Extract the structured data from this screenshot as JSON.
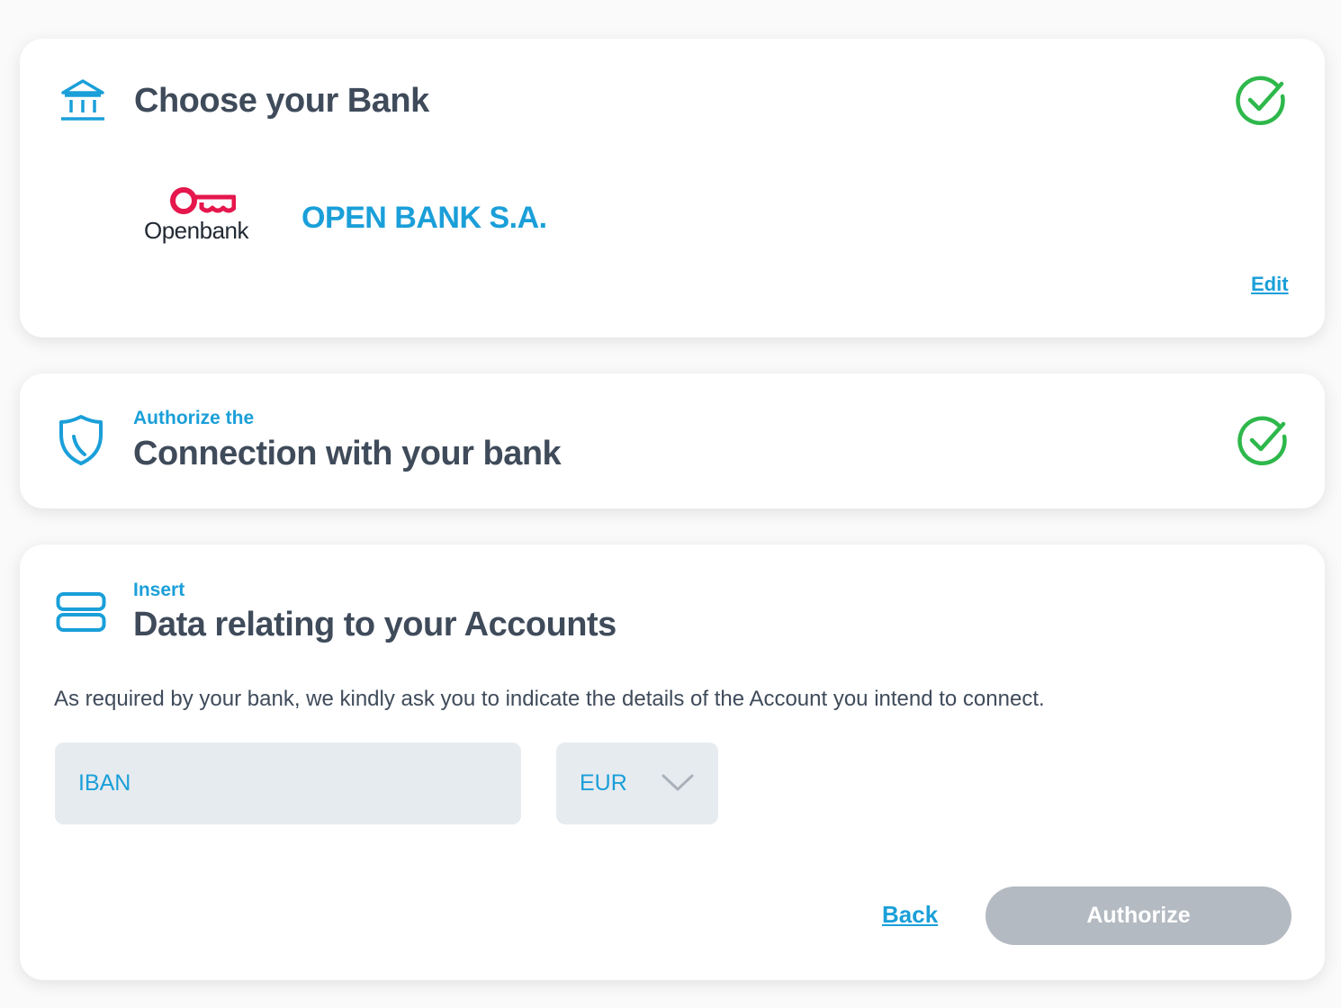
{
  "steps": {
    "bank": {
      "title": "Choose your Bank",
      "bank_name": "OPEN BANK S.A.",
      "bank_logo_text": "Openbank",
      "edit_label": "Edit",
      "status": "completed"
    },
    "authorize": {
      "pretitle": "Authorize the",
      "title": "Connection with your bank",
      "status": "completed"
    },
    "accounts": {
      "pretitle": "Insert",
      "title": "Data relating to your Accounts",
      "description": "As required by your bank, we kindly ask you to indicate the details of the Account you intend to connect.",
      "iban_placeholder": "IBAN",
      "currency_selected": "EUR",
      "back_label": "Back",
      "authorize_label": "Authorize"
    }
  },
  "colors": {
    "accent": "#1a9fd9",
    "success": "#2eb84b",
    "heading": "#3f4b5a",
    "disabled_button": "#b3bac1",
    "field_bg": "#e6ebef",
    "logo_red": "#e5174c"
  },
  "icons": {
    "bank": "bank-icon",
    "shield": "shield-icon",
    "accounts": "accounts-icon",
    "check": "check-circle-icon",
    "chevron": "chevron-down-icon"
  }
}
